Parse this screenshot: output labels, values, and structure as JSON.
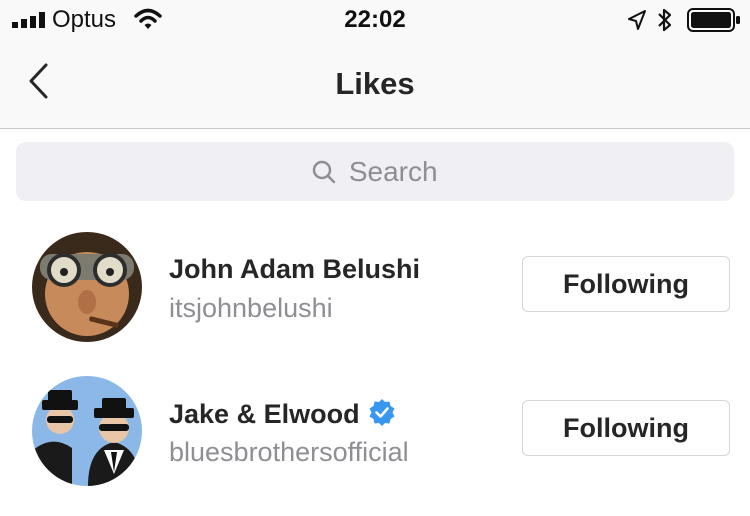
{
  "status_bar": {
    "carrier": "Optus",
    "time": "22:02"
  },
  "nav": {
    "title": "Likes",
    "back_icon": "chevron-left-icon"
  },
  "search": {
    "placeholder": "Search",
    "icon": "search-icon"
  },
  "users": [
    {
      "name": "John Adam Belushi",
      "handle": "itsjohnbelushi",
      "verified": false,
      "button_label": "Following"
    },
    {
      "name": "Jake & Elwood",
      "handle": "bluesbrothersofficial",
      "verified": true,
      "button_label": "Following"
    }
  ],
  "colors": {
    "verified_badge": "#3897f0",
    "secondary_text": "#8e8e93",
    "search_bg": "#efeff4"
  }
}
